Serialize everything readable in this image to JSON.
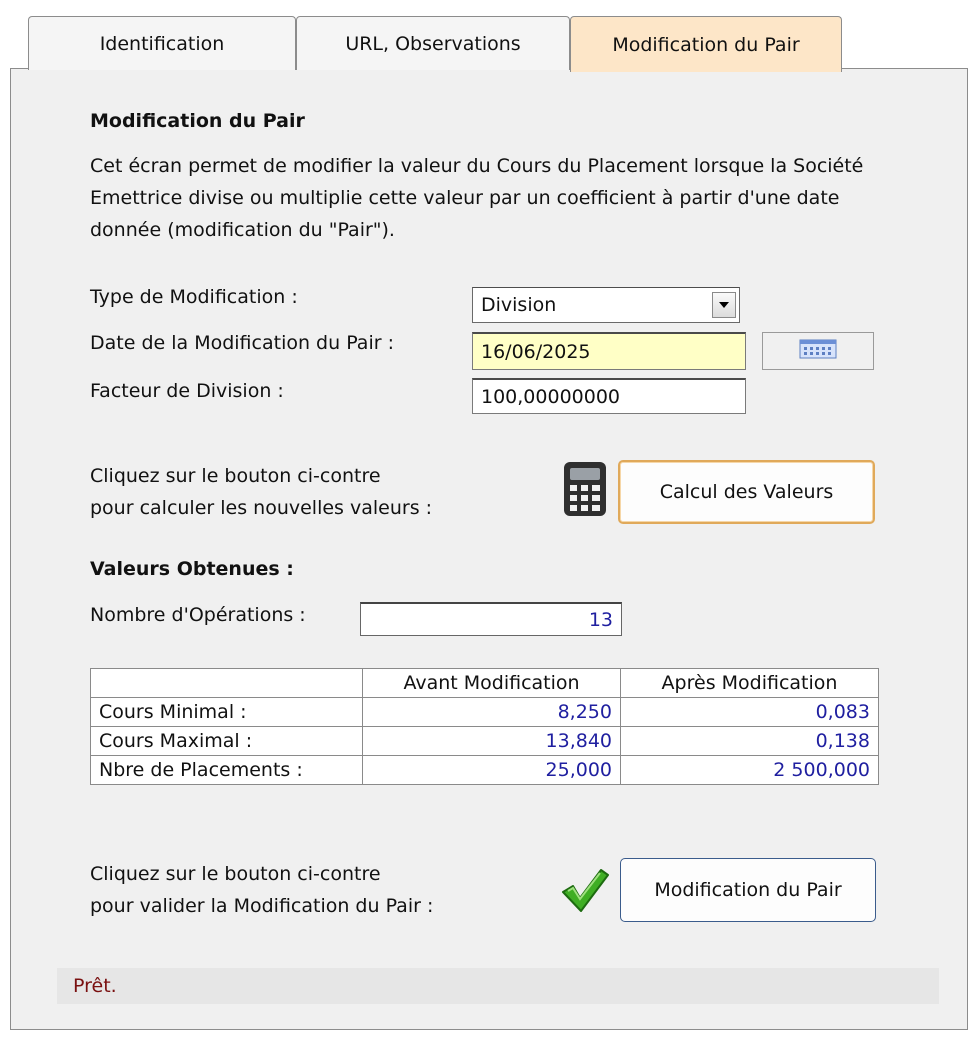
{
  "tabs": [
    {
      "label": "Identification"
    },
    {
      "label": "URL, Observations"
    },
    {
      "label": "Modification du Pair"
    }
  ],
  "panel": {
    "title": "Modification du Pair",
    "description": "Cet écran permet de modifier la valeur du Cours du Placement lorsque la Société Emettrice divise ou multiplie cette valeur par un coefficient à partir d'une date donnée (modification du \"Pair\")."
  },
  "form": {
    "type_label": "Type de Modification :",
    "type_value": "Division",
    "date_label": "Date de la Modification du Pair :",
    "date_value": "16/06/2025",
    "factor_label": "Facteur de Division :",
    "factor_value": "100,00000000"
  },
  "calc": {
    "instruction_line1": "Cliquez sur le bouton ci-contre",
    "instruction_line2": "pour calculer les nouvelles valeurs :",
    "button_label": "Calcul des Valeurs"
  },
  "results": {
    "title": "Valeurs Obtenues :",
    "ops_label": "Nombre d'Opérations :",
    "ops_value": "13",
    "headers": [
      "",
      "Avant Modification",
      "Après Modification"
    ],
    "rows": [
      {
        "label": "Cours Minimal :",
        "before": "8,250",
        "after": "0,083"
      },
      {
        "label": "Cours Maximal :",
        "before": "13,840",
        "after": "0,138"
      },
      {
        "label": "Nbre de Placements :",
        "before": "25,000",
        "after": "2 500,000"
      }
    ]
  },
  "validate": {
    "instruction_line1": "Cliquez sur le bouton ci-contre",
    "instruction_line2": "pour valider la Modification du Pair :",
    "button_label": "Modification du Pair"
  },
  "status": "Prêt.",
  "colors": {
    "active_tab": "#fde6c8",
    "date_field": "#ffffc6",
    "value_text": "#1f1fa0",
    "status_text": "#7a1010"
  },
  "icons": {
    "calendar": "calendar-icon",
    "calculator": "calculator-icon",
    "check": "checkmark-icon"
  }
}
